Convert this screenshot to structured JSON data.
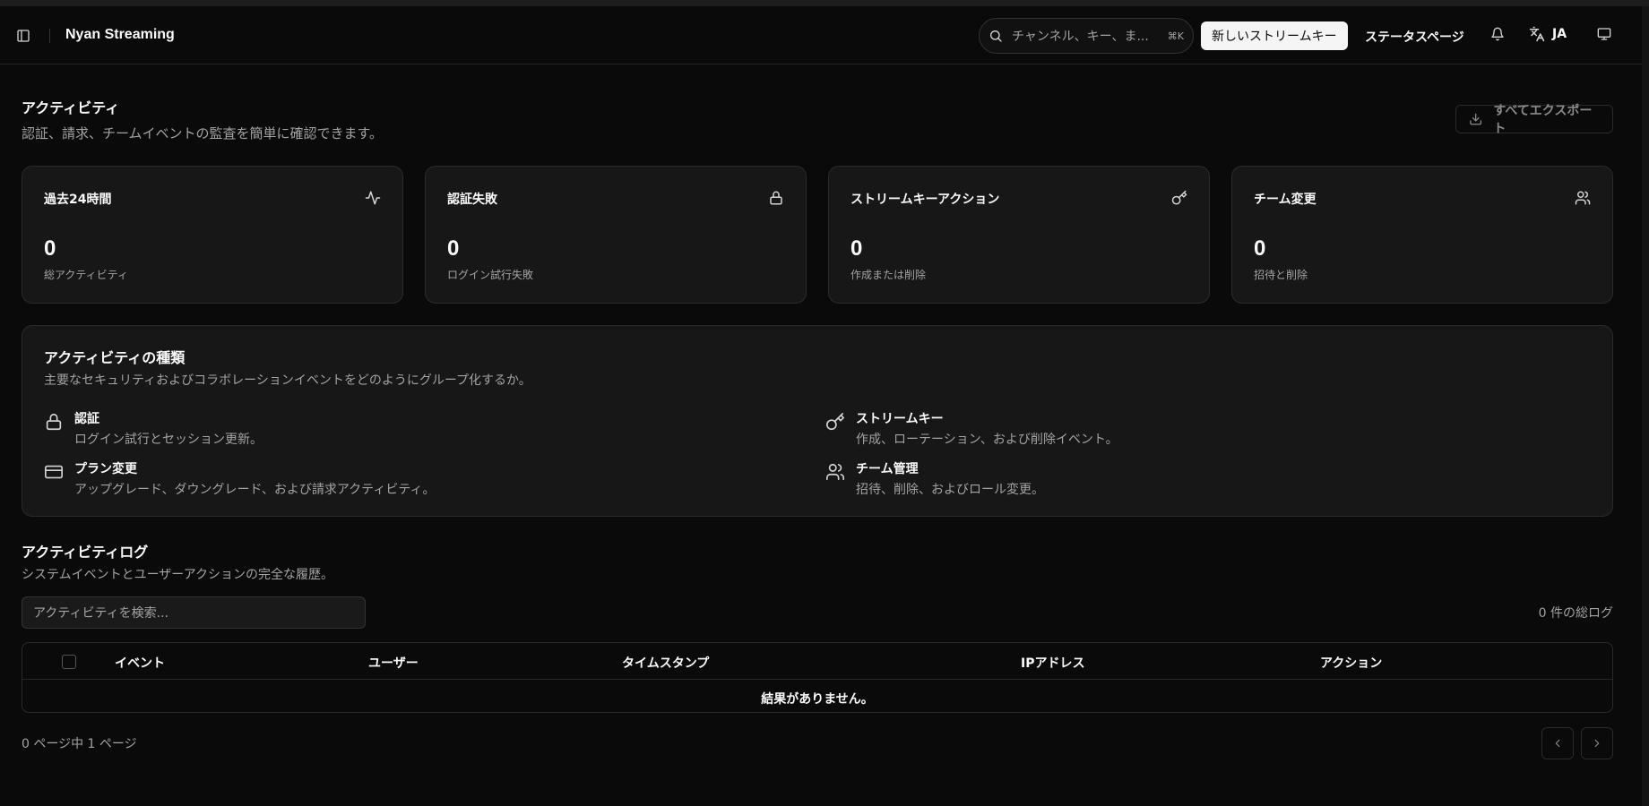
{
  "header": {
    "app_title": "Nyan Streaming",
    "search_placeholder": "チャンネル、キー、ま...",
    "search_shortcut": "⌘K",
    "new_key_label": "新しいストリームキー",
    "status_page_label": "ステータスページ",
    "language": "JA",
    "icons": [
      "sidebar-icon",
      "search-icon",
      "bell-icon",
      "translate-icon",
      "monitor-icon"
    ]
  },
  "page": {
    "title": "アクティビティ",
    "subtitle": "認証、請求、チームイベントの監査を簡単に確認できます。",
    "export_label": "すべてエクスポート"
  },
  "stats": [
    {
      "label": "過去24時間",
      "value": "0",
      "desc": "総アクティビティ",
      "icon": "activity-icon"
    },
    {
      "label": "認証失敗",
      "value": "0",
      "desc": "ログイン試行失敗",
      "icon": "lock-icon"
    },
    {
      "label": "ストリームキーアクション",
      "value": "0",
      "desc": "作成または削除",
      "icon": "key-icon"
    },
    {
      "label": "チーム変更",
      "value": "0",
      "desc": "招待と削除",
      "icon": "users-icon"
    }
  ],
  "types": {
    "title": "アクティビティの種類",
    "subtitle": "主要なセキュリティおよびコラボレーションイベントをどのようにグループ化するか。",
    "items": [
      {
        "name": "認証",
        "desc": "ログイン試行とセッション更新。",
        "icon": "lock-icon"
      },
      {
        "name": "ストリームキー",
        "desc": "作成、ローテーション、および削除イベント。",
        "icon": "key-icon"
      },
      {
        "name": "プラン変更",
        "desc": "アップグレード、ダウングレード、および請求アクティビティ。",
        "icon": "credit-card-icon"
      },
      {
        "name": "チーム管理",
        "desc": "招待、削除、およびロール変更。",
        "icon": "users-icon"
      }
    ]
  },
  "log": {
    "title": "アクティビティログ",
    "subtitle": "システムイベントとユーザーアクションの完全な履歴。",
    "search_placeholder": "アクティビティを検索...",
    "total_count": "0 件の総ログ",
    "columns": [
      "イベント",
      "ユーザー",
      "タイムスタンプ",
      "IPアドレス",
      "アクション"
    ],
    "empty_text": "結果がありません。",
    "pagination": "0 ページ中 1 ページ"
  }
}
